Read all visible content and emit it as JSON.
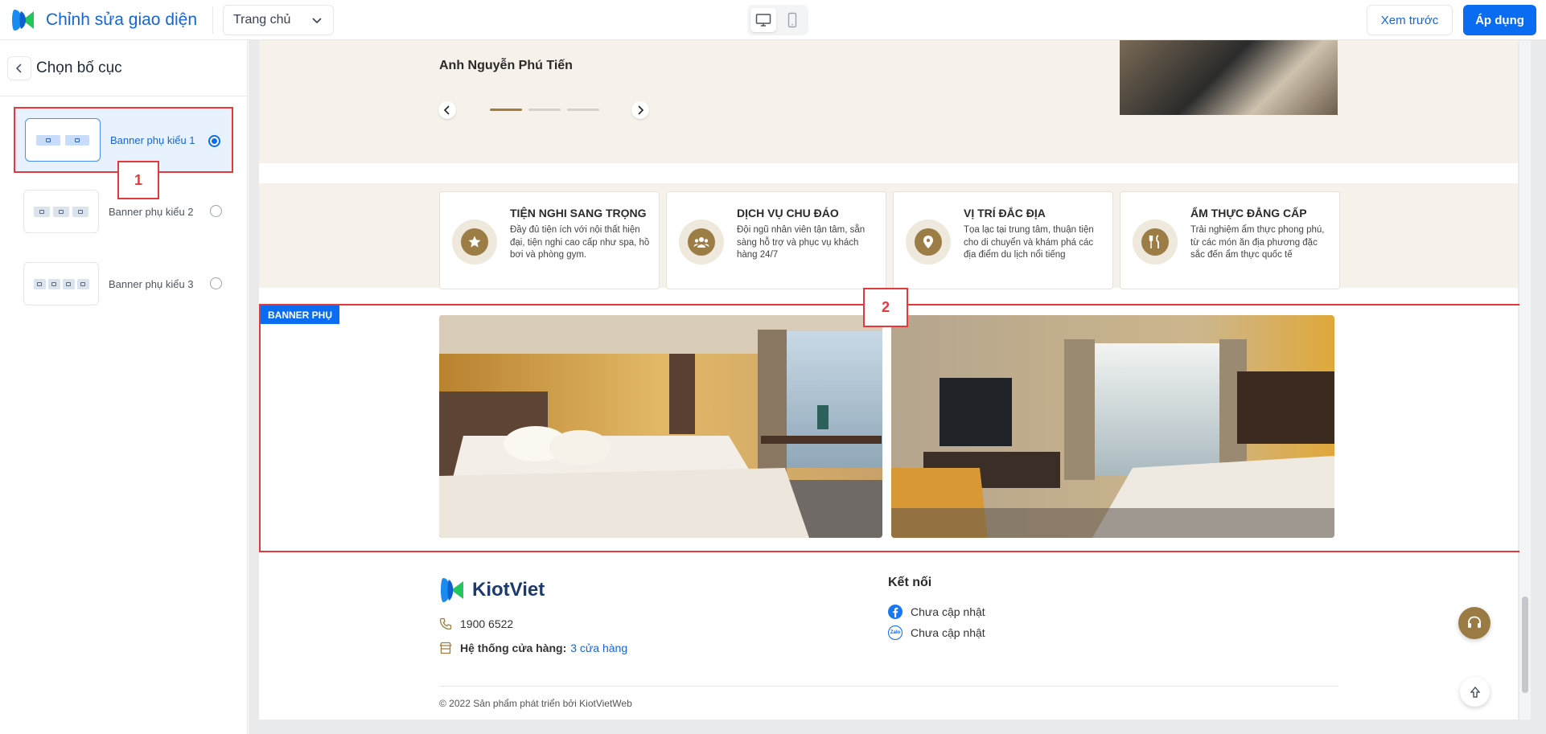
{
  "header": {
    "title": "Chỉnh sửa giao diện",
    "page_select": "Trang chủ",
    "device_options": [
      "desktop-icon",
      "mobile-icon"
    ],
    "preview_label": "Xem trước",
    "apply_label": "Áp dụng"
  },
  "sidebar": {
    "title": "Chọn bố cục",
    "options": [
      {
        "label": "Banner phụ kiểu 1",
        "slots": 2,
        "selected": true
      },
      {
        "label": "Banner phụ kiểu 2",
        "slots": 3,
        "selected": false
      },
      {
        "label": "Banner phụ kiểu 3",
        "slots": 4,
        "selected": false
      }
    ]
  },
  "callouts": [
    "1",
    "2"
  ],
  "preview": {
    "testimonial": {
      "name": "Anh Nguyễn Phú Tiến",
      "slide_count": 3,
      "active_slide": 1
    },
    "features": [
      {
        "title": "TIỆN NGHI SANG TRỌNG",
        "desc": "Đầy đủ tiện ích với nội thất hiện đại, tiện nghi cao cấp như spa, hồ bơi và phòng gym.",
        "icon": "star-icon"
      },
      {
        "title": "DỊCH VỤ CHU ĐÁO",
        "desc": "Đội ngũ nhân viên tận tâm, sẵn sàng hỗ trợ và phục vụ khách hàng 24/7",
        "icon": "team-icon"
      },
      {
        "title": "VỊ TRÍ ĐẮC ĐỊA",
        "desc": "Tọa lạc tại trung tâm, thuận tiện cho di chuyển và khám phá các địa điểm du lịch nổi tiếng",
        "icon": "location-pin-icon"
      },
      {
        "title": "ẨM THỰC ĐẲNG CẤP",
        "desc": "Trải nghiệm ẩm thực phong phú, từ các món ăn địa phương đặc sắc đến ẩm thực quốc tế",
        "icon": "dining-icon"
      }
    ],
    "banner": {
      "tag": "BANNER PHỤ",
      "images": [
        "hotel-room-photo-1",
        "hotel-room-photo-2"
      ]
    },
    "footer": {
      "brand": "KiotViet",
      "phone": "1900 6522",
      "stores_label": "Hệ thống cửa hàng:",
      "stores_link": "3 cửa hàng",
      "connect_title": "Kết nối",
      "facebook": "Chưa cập nhật",
      "zalo": "Chưa cập nhật",
      "zalo_icon_text": "Zalo",
      "copyright": "© 2022 Sản phẩm phát triển bởi KiotVietWeb"
    }
  },
  "colors": {
    "accent_blue": "#0a6cf0",
    "brand_gold": "#9c7d46",
    "highlight_red": "#e5383b",
    "cream_bg": "#f6f1ea"
  }
}
